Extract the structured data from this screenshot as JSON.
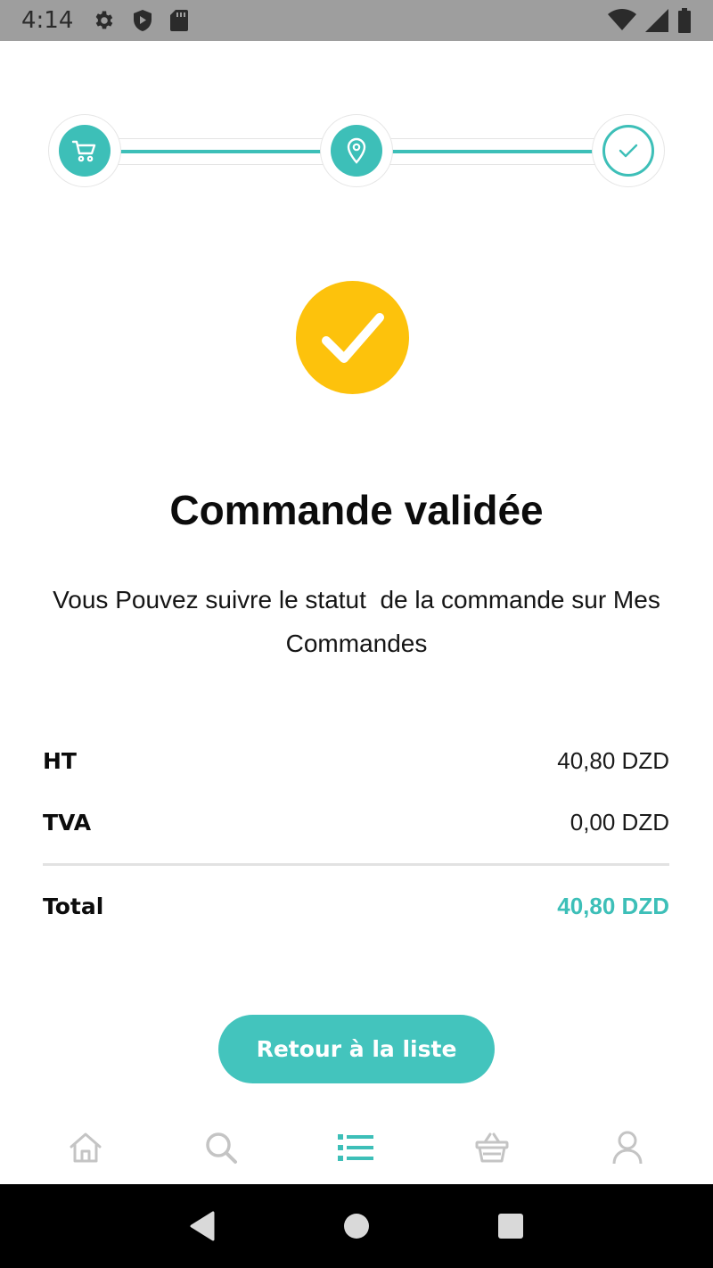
{
  "status_bar": {
    "time": "4:14",
    "left_icons": [
      "gear-icon",
      "shield-icon",
      "sd-card-icon"
    ],
    "right_icons": [
      "wifi-icon",
      "signal-icon",
      "battery-icon"
    ]
  },
  "stepper": {
    "steps": [
      {
        "icon": "cart-icon",
        "state": "done"
      },
      {
        "icon": "location-pin-icon",
        "state": "done"
      },
      {
        "icon": "check-icon",
        "state": "current"
      }
    ],
    "accent": "#3dbfb8"
  },
  "success": {
    "icon": "check-icon",
    "color": "#fdc20c"
  },
  "title": "Commande validée",
  "message": "Vous Pouvez suivre le statut  de la commande sur Mes Commandes",
  "summary": {
    "ht_label": "HT",
    "ht_value": "40,80 DZD",
    "tva_label": "TVA",
    "tva_value": "0,00 DZD",
    "total_label": "Total",
    "total_value": "40,80 DZD"
  },
  "return_button": "Retour à la liste",
  "bottom_nav": {
    "items": [
      {
        "icon": "home-icon",
        "active": false
      },
      {
        "icon": "search-icon",
        "active": false
      },
      {
        "icon": "list-icon",
        "active": true
      },
      {
        "icon": "basket-icon",
        "active": false
      },
      {
        "icon": "user-icon",
        "active": false
      }
    ]
  },
  "system_nav": [
    "back-icon",
    "home-circle-icon",
    "recents-icon"
  ]
}
